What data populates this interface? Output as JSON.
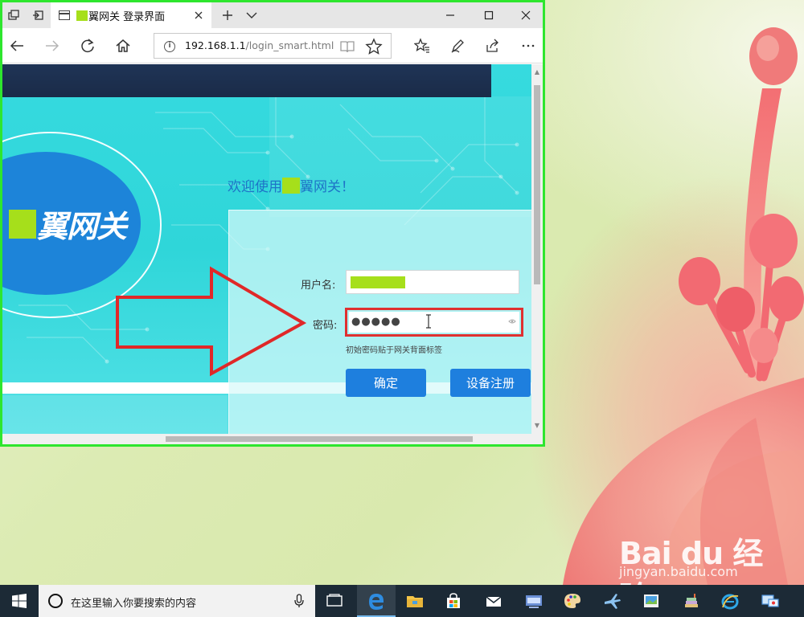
{
  "browser": {
    "tab_title_prefix": "",
    "tab_title": "翼网关 登录界面",
    "address": {
      "host": "192.168.1.1",
      "path": "/login_smart.html"
    }
  },
  "page": {
    "logo_text": "翼网关",
    "welcome_prefix": "欢迎使用",
    "welcome_suffix": "翼网关！",
    "login": {
      "username_label": "用户名:",
      "password_label": "密码:",
      "password_mask": "●●●●●",
      "hint": "初始密码贴于网关背面标签",
      "confirm_label": "确定",
      "register_label": "设备注册"
    }
  },
  "taskbar": {
    "search_placeholder": "在这里输入你要搜索的内容"
  },
  "watermark": {
    "logo": "Bai du 经验",
    "sub": "jingyan.baidu.com"
  },
  "colors": {
    "window_border": "#2ee62e",
    "page_teal": "#36dadf",
    "logo_blue": "#1d84d9",
    "button_blue": "#1e7fde",
    "highlight_red": "#e03030",
    "redaction_green": "#a6df1b",
    "taskbar": "#1c2a36"
  },
  "icons": {
    "tab_actions": [
      "tabs-aside-icon",
      "set-aside-icon"
    ],
    "nav": [
      "back-icon",
      "forward-icon",
      "refresh-icon",
      "home-icon"
    ],
    "address": [
      "info-icon",
      "reading-view-icon",
      "favorite-star-icon"
    ],
    "toolbar": [
      "favorites-hub-icon",
      "web-note-icon",
      "share-icon",
      "more-icon"
    ],
    "taskbar": [
      "windows-start-icon",
      "cortana-icon",
      "microphone-icon",
      "task-view-icon",
      "edge-icon",
      "file-explorer-icon",
      "store-icon",
      "mail-icon",
      "keyboard-app-icon",
      "paint-icon",
      "airplane-app-icon",
      "picture-viewer-icon",
      "books-icon",
      "ie-icon",
      "remote-desktop-icon"
    ]
  }
}
